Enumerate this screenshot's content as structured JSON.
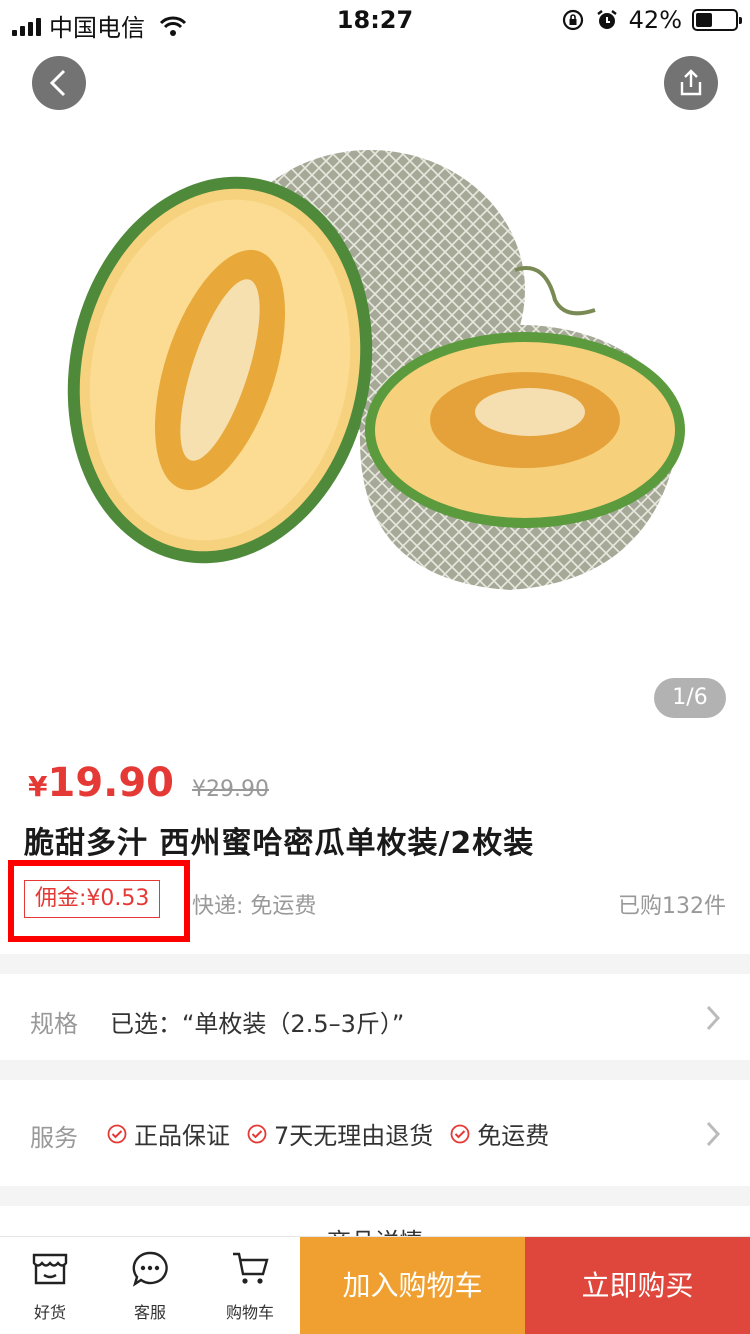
{
  "status_bar": {
    "carrier": "中国电信",
    "time": "18:27",
    "battery_percent": "42%",
    "battery_level": 0.42,
    "icons": [
      "signal-icon",
      "wifi-icon",
      "rotation-lock-icon",
      "alarm-icon",
      "battery-icon"
    ]
  },
  "header": {
    "back_icon": "chevron-left-icon",
    "share_icon": "share-icon"
  },
  "gallery": {
    "indicator": "1/6",
    "current": 1,
    "total": 6
  },
  "product": {
    "price_symbol": "¥",
    "price": "19.90",
    "original_price": "¥29.90",
    "title": "脆甜多汁 西州蜜哈密瓜单枚装/2枚装",
    "commission": "佣金:¥0.53",
    "shipping": "快递: 免运费",
    "sold": "已购132件"
  },
  "spec": {
    "label": "规格",
    "value": "已选：“单枚装（2.5–3斤）”"
  },
  "service": {
    "label": "服务",
    "items": [
      "正品保证",
      "7天无理由退货",
      "免运费"
    ]
  },
  "detail": {
    "title": "商品详情"
  },
  "bottom_bar": {
    "tabs": [
      {
        "label": "好货",
        "icon": "store-icon"
      },
      {
        "label": "客服",
        "icon": "chat-icon"
      },
      {
        "label": "购物车",
        "icon": "cart-icon"
      }
    ],
    "add_to_cart": "加入购物车",
    "buy_now": "立即购买"
  },
  "colors": {
    "accent_red": "#e53935",
    "cart_orange": "#f0a030",
    "buy_red": "#e0473c"
  }
}
